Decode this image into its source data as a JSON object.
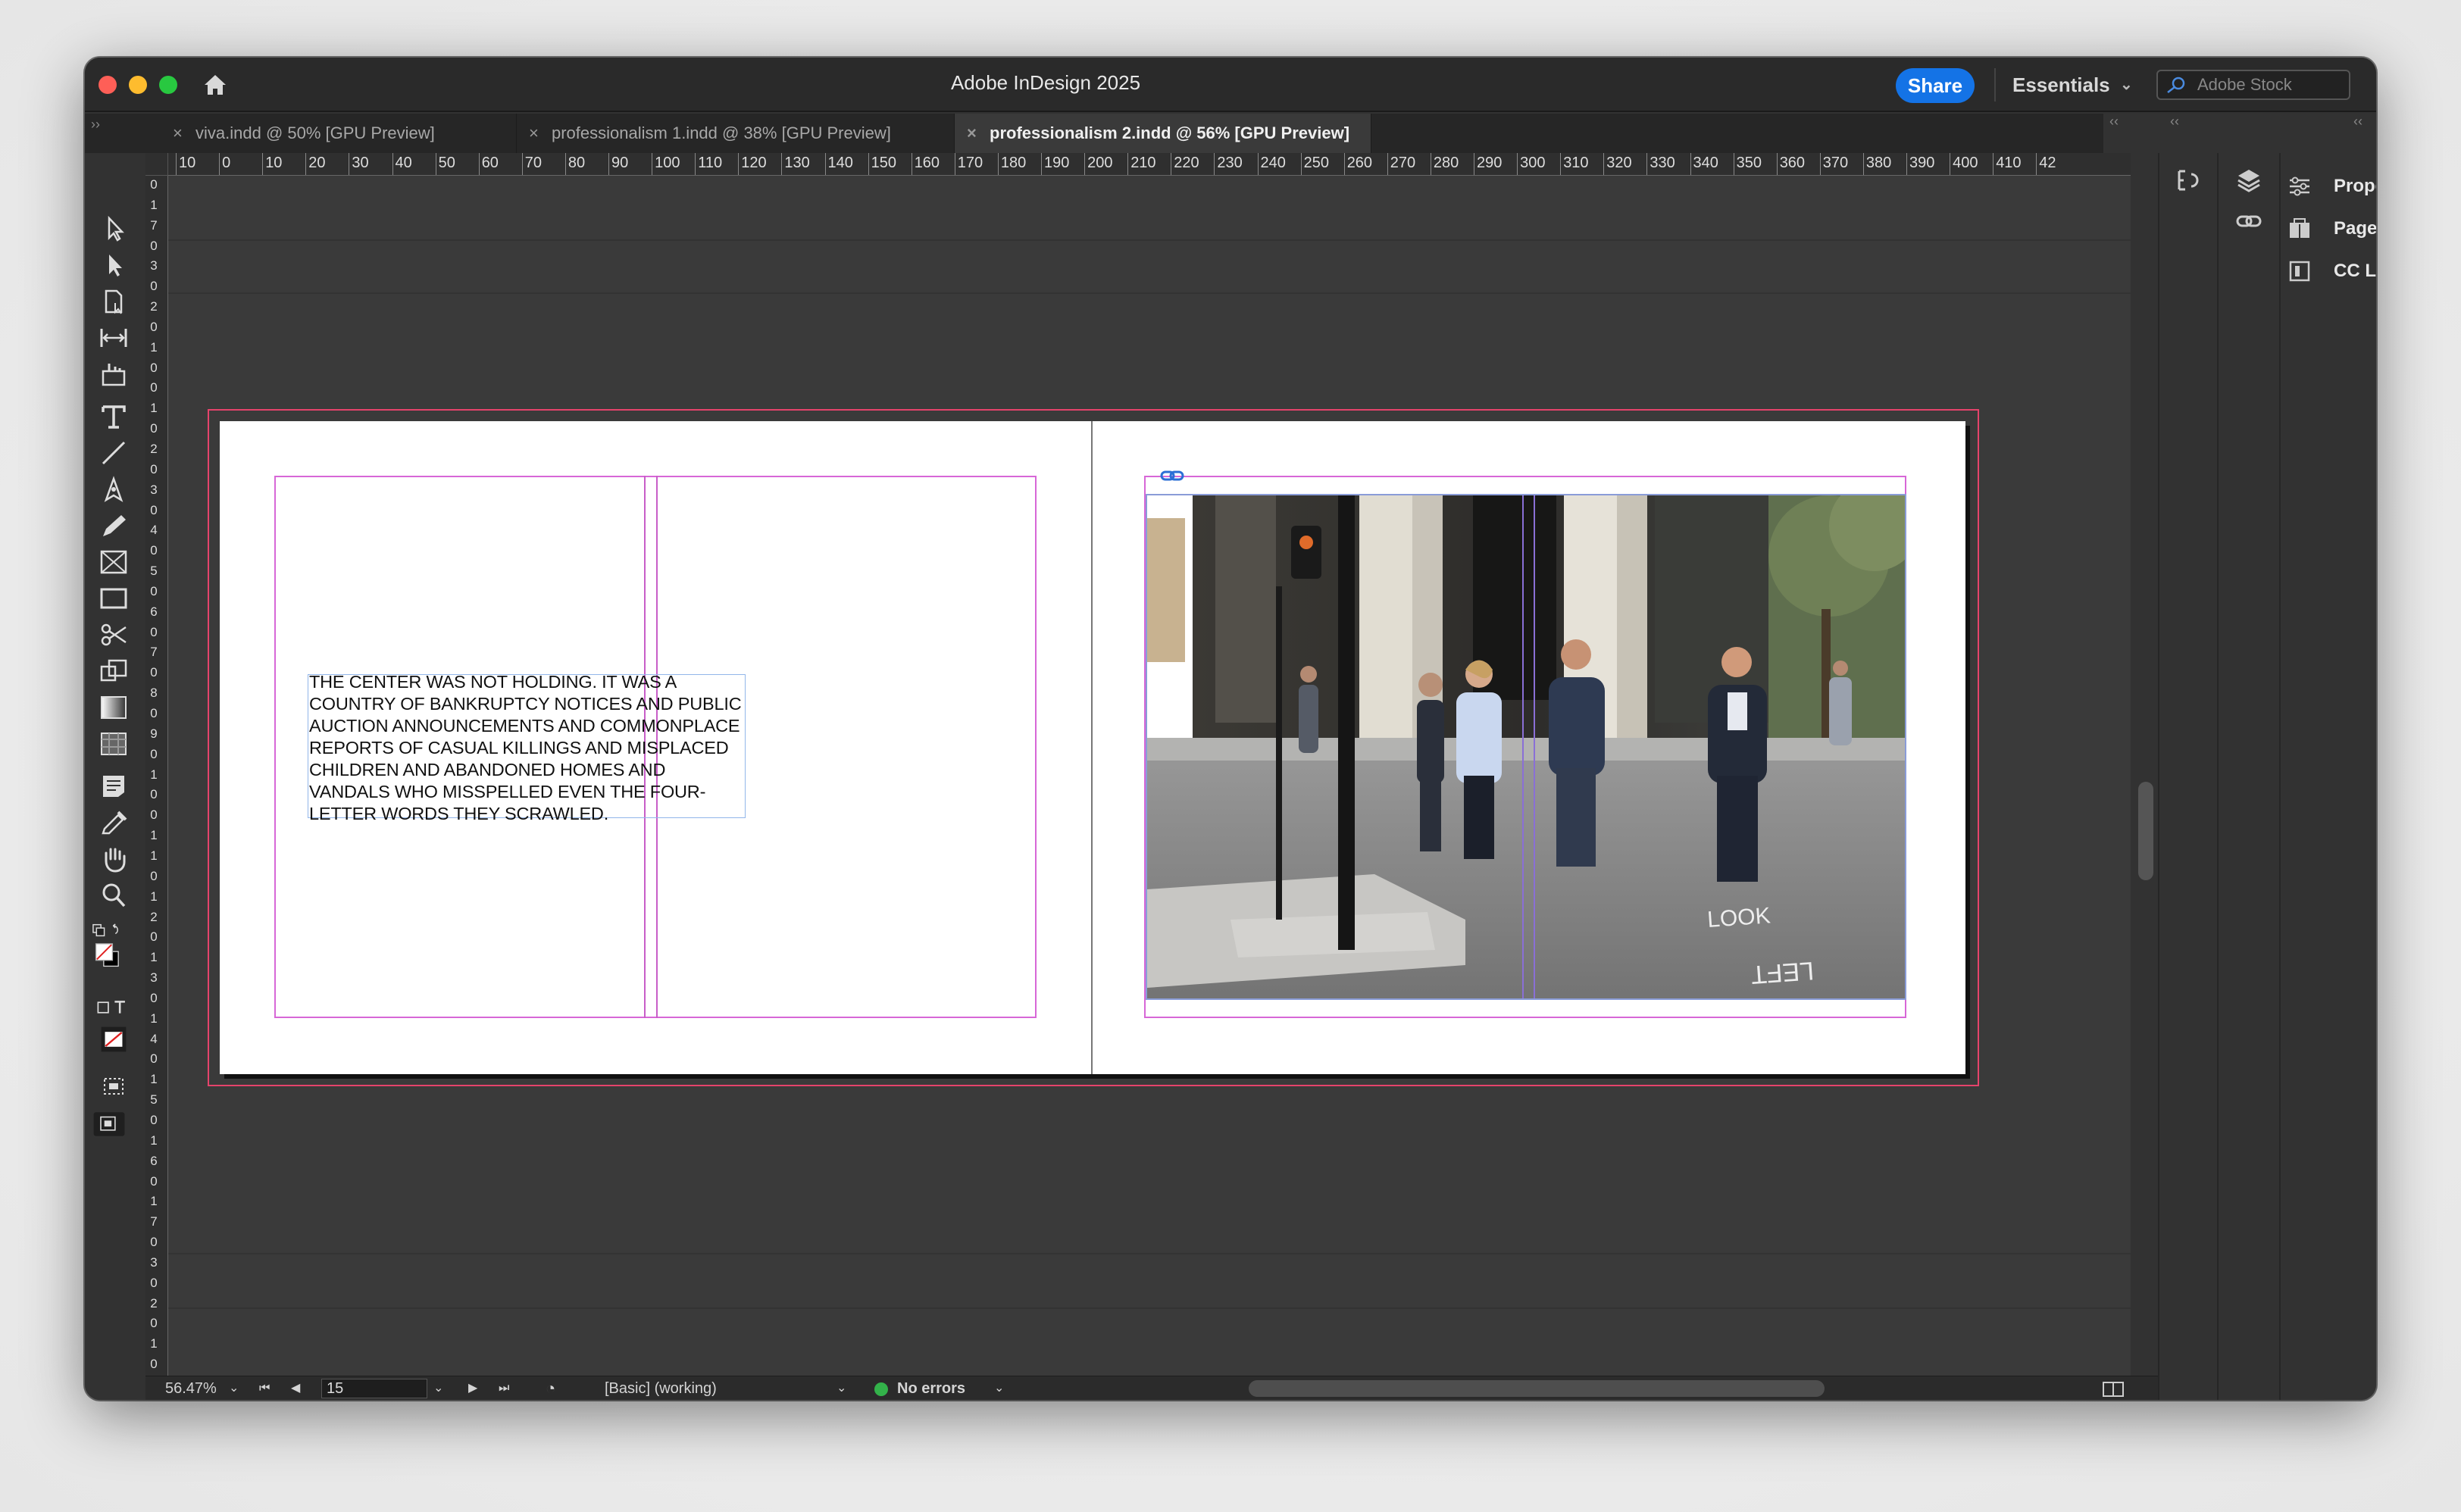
{
  "window": {
    "title": "Adobe InDesign 2025",
    "share_label": "Share",
    "workspace_label": "Essentials",
    "stock_placeholder": "Adobe Stock"
  },
  "tabs": [
    {
      "label": "viva.indd @ 50% [GPU Preview]",
      "active": false
    },
    {
      "label": "professionalism 1.indd @ 38% [GPU Preview]",
      "active": false
    },
    {
      "label": "professionalism 2.indd @ 56% [GPU Preview]",
      "active": true
    }
  ],
  "tab_close_glyph": "×",
  "ruler": {
    "h_labels": [
      "10",
      "0",
      "10",
      "20",
      "30",
      "40",
      "50",
      "60",
      "70",
      "80",
      "90",
      "100",
      "110",
      "120",
      "130",
      "140",
      "150",
      "160",
      "170",
      "180",
      "190",
      "200",
      "210",
      "220",
      "230",
      "240",
      "250",
      "260",
      "270",
      "280",
      "290",
      "300",
      "310",
      "320",
      "330",
      "340",
      "350",
      "360",
      "370",
      "380",
      "390",
      "400",
      "410",
      "42"
    ],
    "v_labels": [
      "0",
      "1",
      "7",
      "0",
      "3",
      "0",
      "2",
      "0",
      "1",
      "0",
      "0",
      "1",
      "0",
      "2",
      "0",
      "3",
      "0",
      "4",
      "0",
      "5",
      "0",
      "6",
      "0",
      "7",
      "0",
      "8",
      "0",
      "9",
      "0",
      "1",
      "0",
      "0",
      "1",
      "1",
      "0",
      "1",
      "2",
      "0",
      "1",
      "3",
      "0",
      "1",
      "4",
      "0",
      "1",
      "5",
      "0",
      "1",
      "6",
      "0",
      "1",
      "7",
      "0",
      "3",
      "0",
      "2",
      "0",
      "1",
      "0"
    ]
  },
  "document": {
    "body_text": "THE CENTER WAS NOT HOLDING. IT WAS A COUNTRY OF BANKRUPTCY NOTICES AND PUBLIC AUCTION ANNOUNCEMENTS AND COMMONPLACE REPORTS OF CASUAL KILLINGS AND MISPLACED CHILDREN AND ABANDONED HOMES AND VANDALS WHO MISSPELLED EVEN THE FOUR-LETTER WORDS THEY SCRAWLED.",
    "photo_road_text": [
      "LOOK",
      "LEFT"
    ]
  },
  "status": {
    "zoom": "56.47%",
    "page": "15",
    "profile": "[Basic] (working)",
    "errors": "No errors"
  },
  "panels": [
    {
      "label": "Properties",
      "icon": "properties-icon"
    },
    {
      "label": "Pages",
      "icon": "pages-icon"
    },
    {
      "label": "CC Libraries",
      "icon": "cc-libraries-icon"
    }
  ],
  "colors": {
    "accent": "#1473e6",
    "bleed": "#e5436b",
    "margin": "#d767d7",
    "status_ok": "#33b24a"
  }
}
